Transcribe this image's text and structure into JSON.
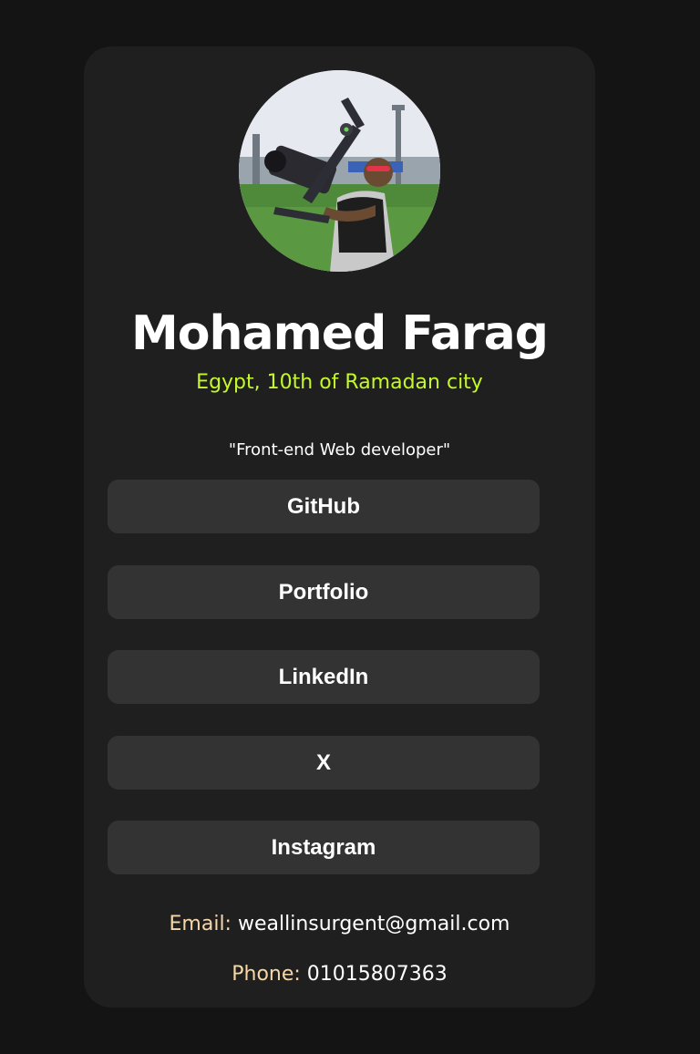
{
  "profile": {
    "name": "Mohamed Farag",
    "location": "Egypt, 10th of Ramadan city",
    "bio": "\"Front-end Web developer\"",
    "avatar_alt": "profile photo"
  },
  "links": [
    {
      "label": "GitHub"
    },
    {
      "label": "Portfolio"
    },
    {
      "label": "LinkedIn"
    },
    {
      "label": "X"
    },
    {
      "label": "Instagram"
    }
  ],
  "contact": {
    "email_label": "Email:",
    "email_value": "weallinsurgent@gmail.com",
    "phone_label": "Phone:",
    "phone_value": "01015807363"
  },
  "colors": {
    "page_background": "#141414",
    "card_background": "#1f1f1f",
    "button_background": "#333333",
    "location_accent": "#c5f82a",
    "contact_label": "#f6d7a7"
  }
}
